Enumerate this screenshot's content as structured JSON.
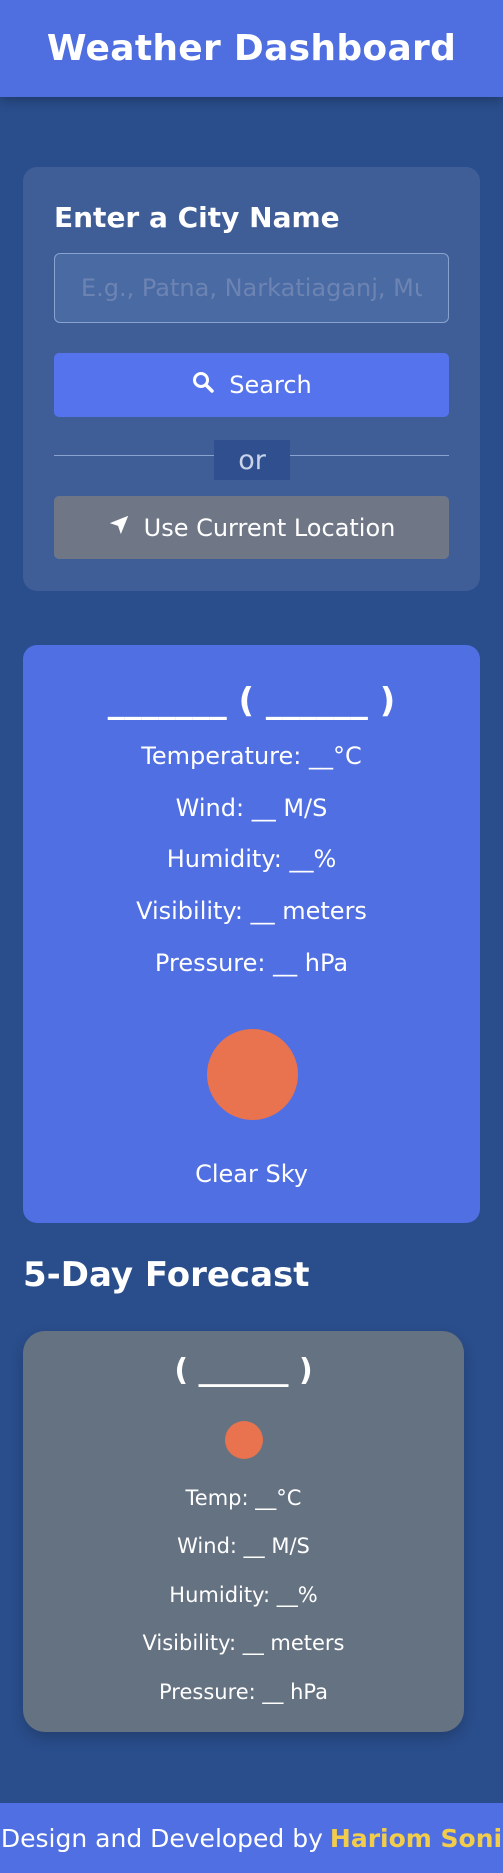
{
  "header": {
    "title": "Weather Dashboard"
  },
  "search": {
    "label": "Enter a City Name",
    "placeholder": "E.g., Patna, Narkatiaganj, Mumbai",
    "search_button": "Search",
    "search_icon": "search-icon",
    "or_text": "or",
    "location_button": "Use Current Location",
    "location_icon": "location-arrow-icon"
  },
  "current": {
    "city": "_______ ( ______ )",
    "temperature": "Temperature: __°C",
    "wind": "Wind: __ M/S",
    "humidity": "Humidity: __%",
    "visibility": "Visibility: __ meters",
    "pressure": "Pressure: __ hPa",
    "icon": "sun-icon",
    "description": "Clear Sky"
  },
  "forecast": {
    "title": "5-Day Forecast",
    "days": [
      {
        "date": "( ______ )",
        "icon": "sun-icon",
        "temp": "Temp: __°C",
        "wind": "Wind: __ M/S",
        "humidity": "Humidity: __%",
        "visibility": "Visibility: __ meters",
        "pressure": "Pressure: __ hPa"
      }
    ]
  },
  "footer": {
    "text": "Design and Developed by",
    "author": "Hariom Soni"
  },
  "colors": {
    "background": "#2a4e8c",
    "accent": "#506fe2",
    "sun": "#e8734e",
    "author_highlight": "#f2cd4b"
  }
}
